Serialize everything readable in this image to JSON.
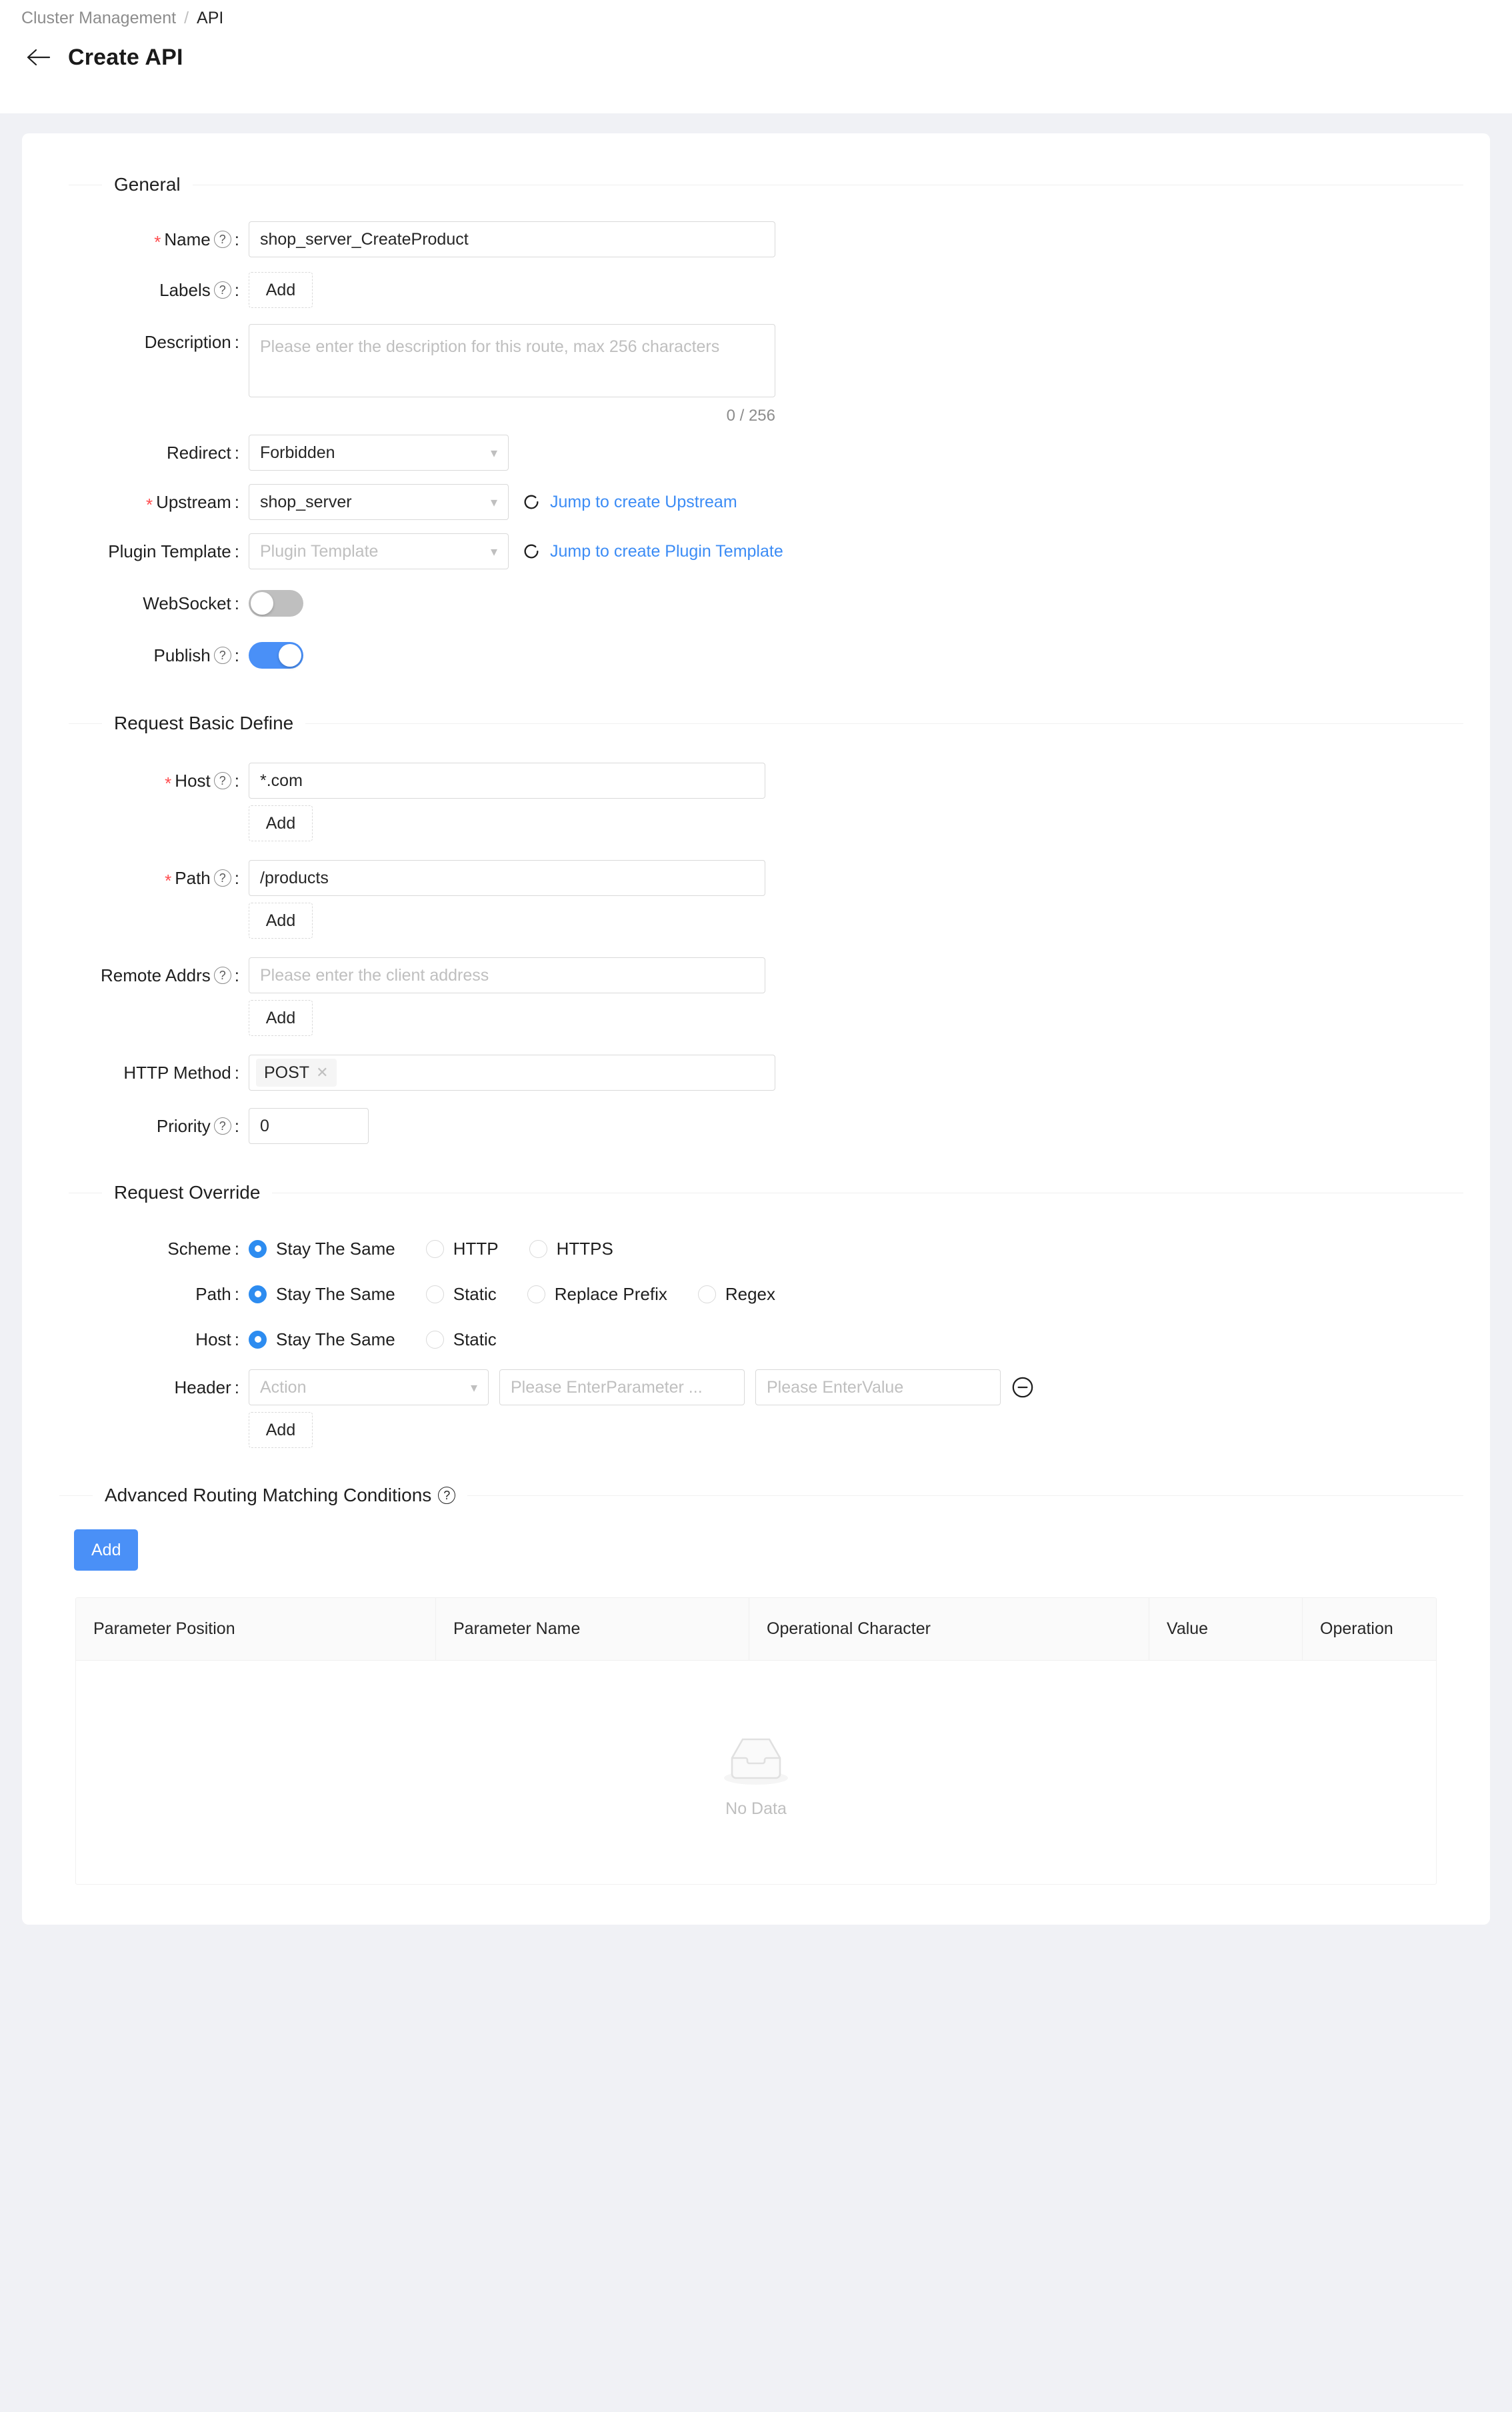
{
  "breadcrumb": {
    "parent": "Cluster Management",
    "separator": "/",
    "current": "API"
  },
  "header": {
    "title": "Create API",
    "back_icon": "arrow-left-icon"
  },
  "sections": {
    "general": "General",
    "request_basic_define": "Request Basic Define",
    "request_override": "Request Override",
    "advanced_routing": "Advanced Routing Matching Conditions"
  },
  "general": {
    "name": {
      "label": "Name",
      "value": "shop_server_CreateProduct",
      "required": true
    },
    "labels": {
      "label": "Labels",
      "add": "Add"
    },
    "description": {
      "label": "Description",
      "placeholder": "Please enter the description for this route, max 256 characters",
      "counter": "0 / 256"
    },
    "redirect": {
      "label": "Redirect",
      "value": "Forbidden"
    },
    "upstream": {
      "label": "Upstream",
      "value": "shop_server",
      "required": true,
      "link": "Jump to create Upstream"
    },
    "plugin_template": {
      "label": "Plugin Template",
      "placeholder": "Plugin Template",
      "link": "Jump to create Plugin Template"
    },
    "websocket": {
      "label": "WebSocket",
      "state": "off"
    },
    "publish": {
      "label": "Publish",
      "state": "on"
    }
  },
  "request_basic": {
    "host": {
      "label": "Host",
      "value": "*.com",
      "required": true,
      "add": "Add"
    },
    "path": {
      "label": "Path",
      "value": "/products",
      "required": true,
      "add": "Add"
    },
    "remote_addrs": {
      "label": "Remote Addrs",
      "placeholder": "Please enter the client address",
      "add": "Add"
    },
    "http_method": {
      "label": "HTTP Method",
      "tags": [
        "POST"
      ]
    },
    "priority": {
      "label": "Priority",
      "value": "0"
    }
  },
  "request_override": {
    "scheme": {
      "label": "Scheme",
      "options": [
        "Stay The Same",
        "HTTP",
        "HTTPS"
      ],
      "selected": "Stay The Same"
    },
    "path": {
      "label": "Path",
      "options": [
        "Stay The Same",
        "Static",
        "Replace Prefix",
        "Regex"
      ],
      "selected": "Stay The Same"
    },
    "host": {
      "label": "Host",
      "options": [
        "Stay The Same",
        "Static"
      ],
      "selected": "Stay The Same"
    },
    "header": {
      "label": "Header",
      "action_placeholder": "Action",
      "param_placeholder": "Please EnterParameter ...",
      "value_placeholder": "Please EnterValue",
      "remove_icon": "minus-circle-icon",
      "add": "Add"
    }
  },
  "advanced_routing": {
    "add_button": "Add",
    "columns": [
      "Parameter Position",
      "Parameter Name",
      "Operational Character",
      "Value",
      "Operation"
    ],
    "rows": [],
    "empty_text": "No Data"
  },
  "colors": {
    "primary": "#4a90f7",
    "link": "#3c8cf5",
    "required": "#ff4d4f",
    "radio_selected": "#2d8cf0",
    "switch_off": "#bfbfbf",
    "page_bg": "#f0f1f5"
  }
}
